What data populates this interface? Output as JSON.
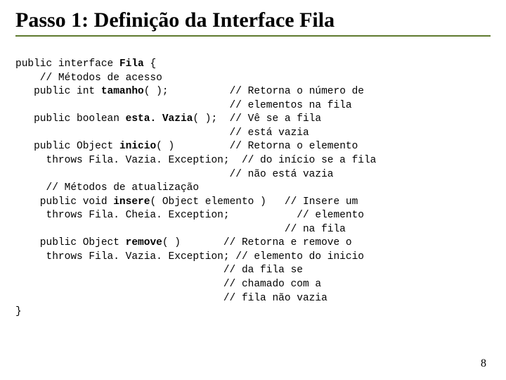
{
  "title": "Passo 1: Definição da Interface Fila",
  "page_number": "8",
  "code": {
    "l01a": "public interface ",
    "l01b": "Fila",
    "l01c": " {",
    "l02": "    // Métodos de acesso",
    "l03a": "   public int ",
    "l03b": "tamanho",
    "l03c": "( );          // Retorna o número de",
    "l04": "                                   // elementos na fila",
    "l05a": "   public boolean ",
    "l05b": "esta. Vazia",
    "l05c": "( );  // Vê se a fila",
    "l06": "                                   // está vazia",
    "l07a": "   public Object ",
    "l07b": "inicio",
    "l07c": "( )         // Retorna o elemento",
    "l08": "     throws Fila. Vazia. Exception;  // do início se a fila",
    "l09": "                                   // não está vazia",
    "l10": "     // Métodos de atualização",
    "l11a": "    public void ",
    "l11b": "insere",
    "l11c": "( Object elemento )   // Insere um",
    "l12": "     throws Fila. Cheia. Exception;           // elemento",
    "l13": "                                            // na fila",
    "l14a": "    public Object ",
    "l14b": "remove",
    "l14c": "( )       // Retorna e remove o",
    "l15": "     throws Fila. Vazia. Exception; // elemento do inicio",
    "l16": "                                  // da fila se",
    "l17": "                                  // chamado com a",
    "l18": "                                  // fila não vazia",
    "l19": "}"
  }
}
